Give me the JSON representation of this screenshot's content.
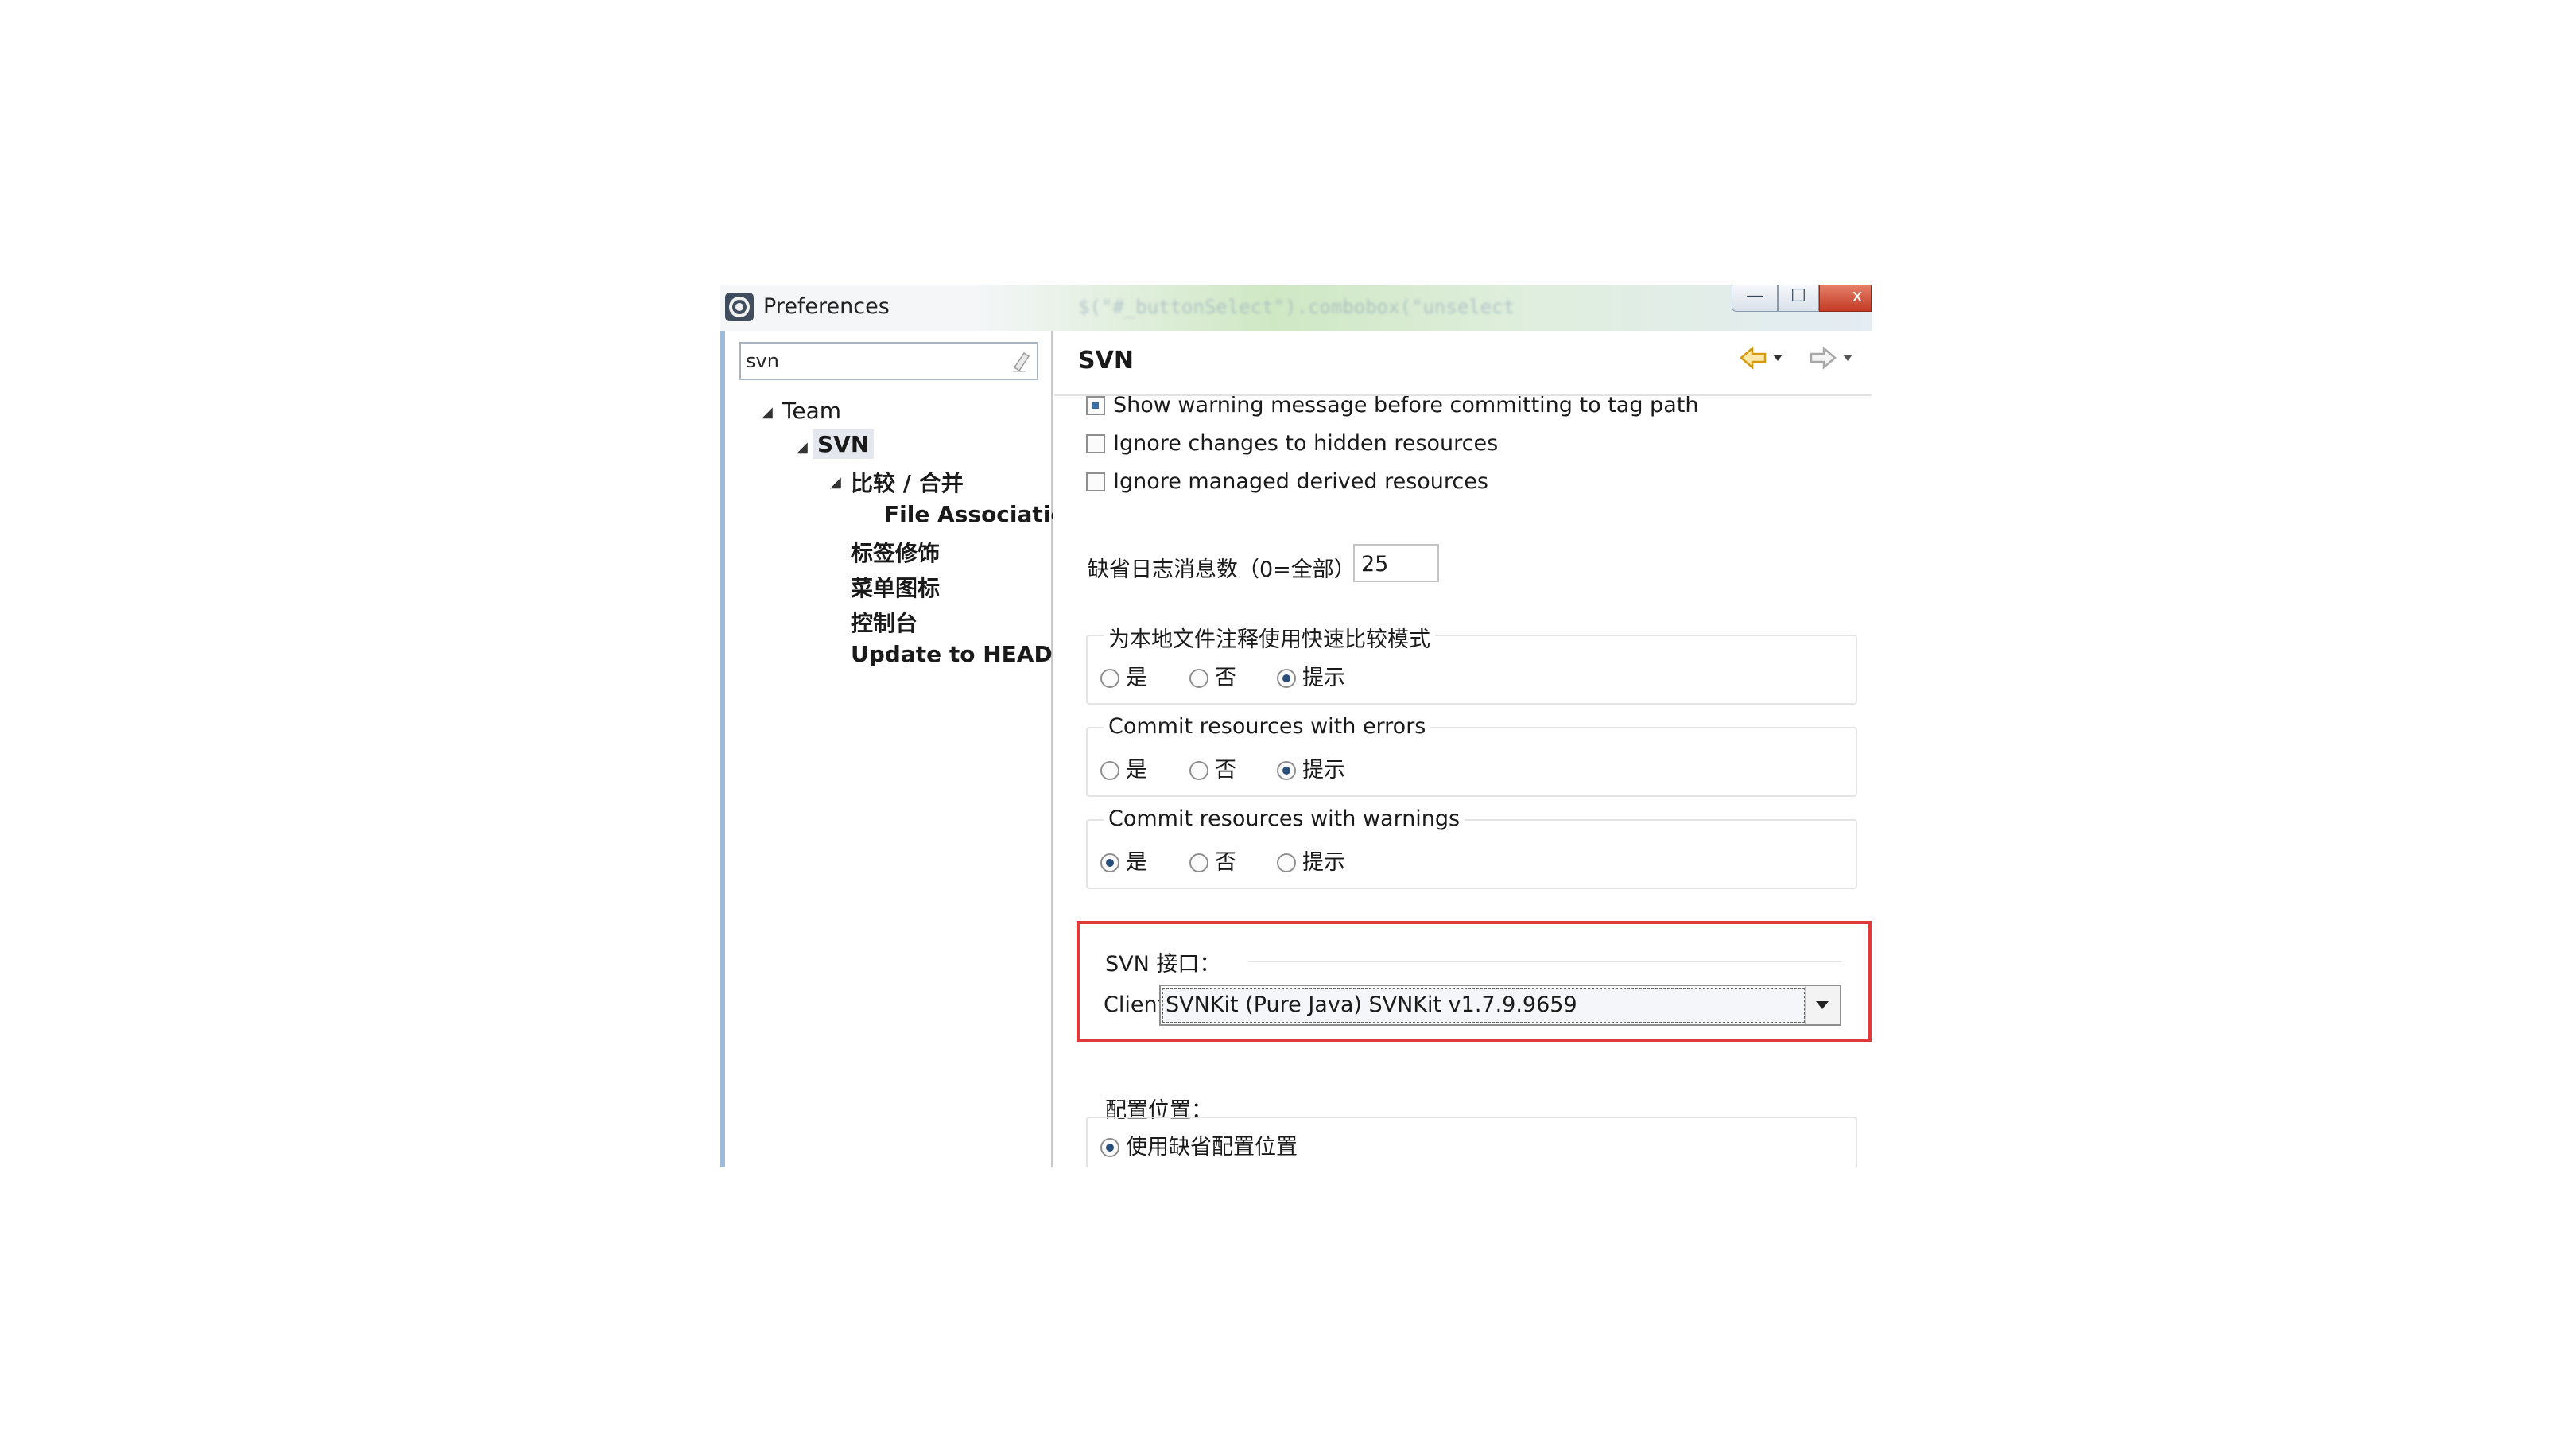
{
  "window": {
    "title": "Preferences",
    "background_code_snippet": "$(\"#_buttonSelect\").combobox(\"unselect"
  },
  "window_controls": {
    "minimize": "—",
    "maximize": "☐",
    "close": "x"
  },
  "left_panel": {
    "search_value": "svn",
    "tree": [
      {
        "label": "Team",
        "bold": false,
        "level": 0,
        "expanded": true
      },
      {
        "label": "SVN",
        "bold": true,
        "level": 1,
        "expanded": true,
        "selected": true
      },
      {
        "label": "比较 / 合并",
        "bold": true,
        "level": 2,
        "expanded": true
      },
      {
        "label": "File Associatic",
        "bold": true,
        "level": 3
      },
      {
        "label": "标签修饰",
        "bold": true,
        "level": 2
      },
      {
        "label": "菜单图标",
        "bold": true,
        "level": 2
      },
      {
        "label": "控制台",
        "bold": true,
        "level": 2
      },
      {
        "label": "Update to HEAD",
        "bold": true,
        "level": 2
      }
    ]
  },
  "right_panel": {
    "heading": "SVN",
    "cut_checkbox_label": "Show warning message before committing to tag path",
    "checkboxes": [
      {
        "label": "Ignore changes to hidden resources",
        "checked": false
      },
      {
        "label": "Ignore managed derived resources",
        "checked": false
      }
    ],
    "log_count_label": "缺省日志消息数（0=全部）",
    "log_count_value": "25",
    "groups": [
      {
        "title": "为本地文件注释使用快速比较模式",
        "options": [
          "是",
          "否",
          "提示"
        ],
        "selected": 2
      },
      {
        "title": "Commit resources with errors",
        "options": [
          "是",
          "否",
          "提示"
        ],
        "selected": 2
      },
      {
        "title": "Commit resources with warnings",
        "options": [
          "是",
          "否",
          "提示"
        ],
        "selected": 0
      }
    ],
    "svn_interface": {
      "title": "SVN 接口：",
      "client_label": "Client:",
      "client_value": "SVNKit (Pure Java) SVNKit v1.7.9.9659"
    },
    "config_location": {
      "title": "配置位置：",
      "option": "使用缺省配置位置",
      "selected": true
    }
  },
  "colors": {
    "highlight_box": "#e03a3a",
    "nav_back_arrow": "#e0a020"
  }
}
